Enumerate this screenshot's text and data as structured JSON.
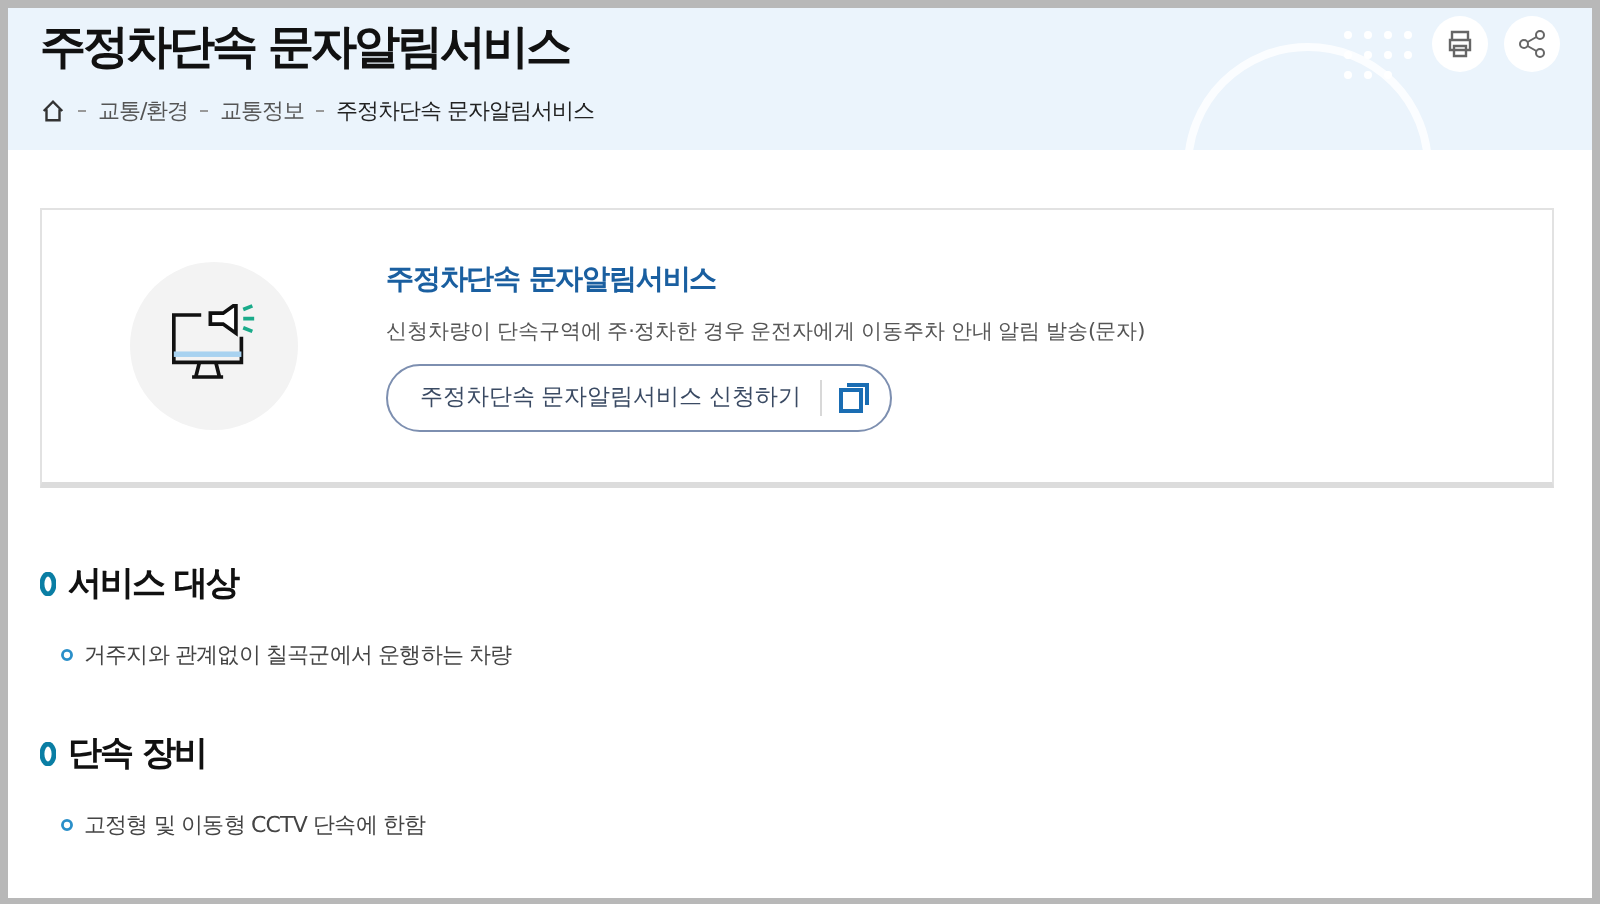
{
  "page_title": "주정차단속 문자알림서비스",
  "breadcrumb": [
    "교통/환경",
    "교통정보",
    "주정차단속 문자알림서비스"
  ],
  "service_card": {
    "title": "주정차단속 문자알림서비스",
    "description": "신청차량이 단속구역에 주·정차한 경우 운전자에게 이동주차 안내 알림 발송(문자)",
    "button": "주정차단속 문자알림서비스 신청하기"
  },
  "sections": [
    {
      "heading": "서비스 대상",
      "items": [
        "거주지와 관계없이 칠곡군에서 운행하는 차량"
      ]
    },
    {
      "heading": "단속 장비",
      "items": [
        "고정형 및 이동형 CCTV 단속에 한함"
      ]
    }
  ]
}
